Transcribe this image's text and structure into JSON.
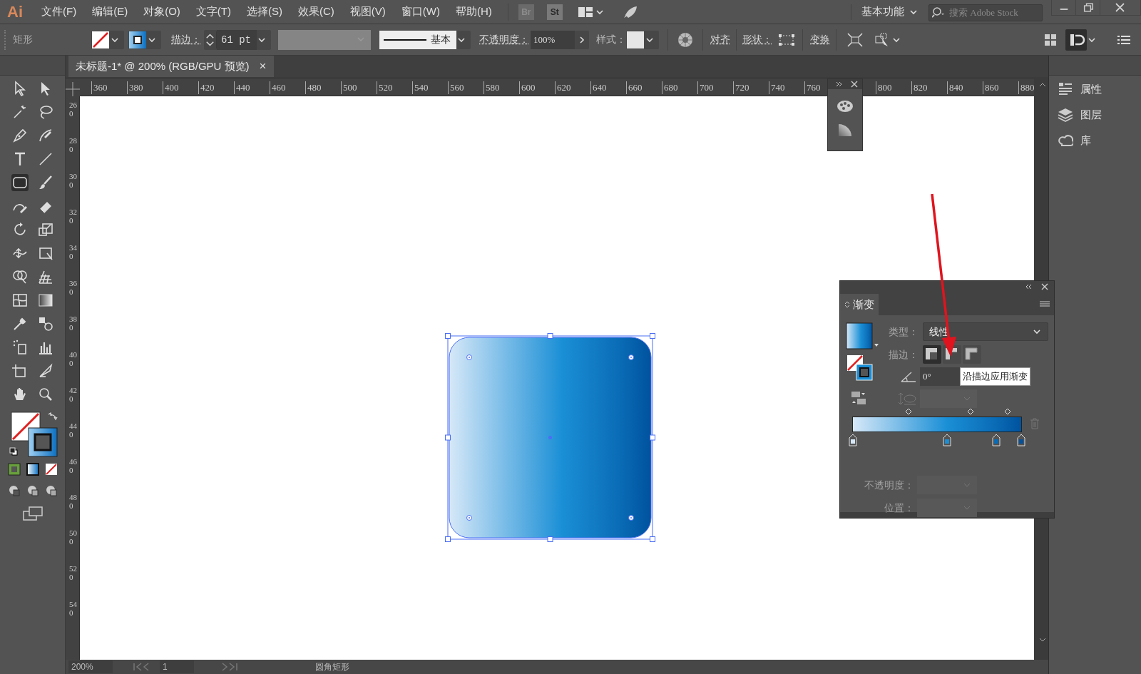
{
  "app_logo": "Ai",
  "menu": [
    "文件(F)",
    "编辑(E)",
    "对象(O)",
    "文字(T)",
    "选择(S)",
    "效果(C)",
    "视图(V)",
    "窗口(W)",
    "帮助(H)"
  ],
  "bridge_badges": [
    "Br",
    "St"
  ],
  "workspace": {
    "label": "基本功能"
  },
  "search": {
    "placeholder": "搜索 Adobe Stock"
  },
  "control_bar": {
    "object_type": "矩形",
    "stroke_label": "描边：",
    "stroke_value": "61 pt",
    "stroke_profile": "基本",
    "opacity_label": "不透明度：",
    "opacity_value": "100%",
    "style_label": "样式：",
    "align": "对齐",
    "shape_label": "形状：",
    "transform": "变换"
  },
  "document_tab": {
    "title": "未标题-1* @ 200% (RGB/GPU 预览)",
    "close": "×"
  },
  "ruler": {
    "horizontal": [
      "360",
      "380",
      "400",
      "420",
      "440",
      "460",
      "480",
      "500",
      "520",
      "540",
      "560",
      "580",
      "600",
      "620",
      "640",
      "660",
      "680",
      "700",
      "720",
      "740",
      "760",
      "800",
      "820",
      "840",
      "860",
      "880"
    ],
    "vertical": [
      "260",
      "280",
      "300",
      "320",
      "340",
      "360",
      "380",
      "400",
      "420",
      "440",
      "460",
      "480",
      "500",
      "520",
      "540"
    ]
  },
  "right_panels": [
    {
      "label": "属性"
    },
    {
      "label": "图层"
    },
    {
      "label": "库"
    }
  ],
  "gradient_panel": {
    "title": "渐变",
    "type_label": "类型：",
    "type_value": "线性",
    "stroke_label": "描边：",
    "stroke_buttons": [
      {
        "selected": true
      },
      {
        "selected": false
      },
      {
        "selected": false
      }
    ],
    "angle": "0°",
    "tooltip": "沿描边应用渐变",
    "opacity_label": "不透明度：",
    "position_label": "位置：",
    "stops": [
      {
        "level": 0,
        "color": "#d6e8f8"
      },
      {
        "level": 0.56,
        "color": "#1a8fd6"
      },
      {
        "level": 0.85,
        "color": "#0a6bb5"
      },
      {
        "level": 1,
        "color": "#00529e"
      }
    ],
    "midpoints": [
      {
        "level": 0.33
      },
      {
        "level": 0.7
      },
      {
        "level": 0.92
      }
    ]
  },
  "status_bar": {
    "zoom": "200%",
    "page": "1",
    "tool": "圆角矩形"
  }
}
